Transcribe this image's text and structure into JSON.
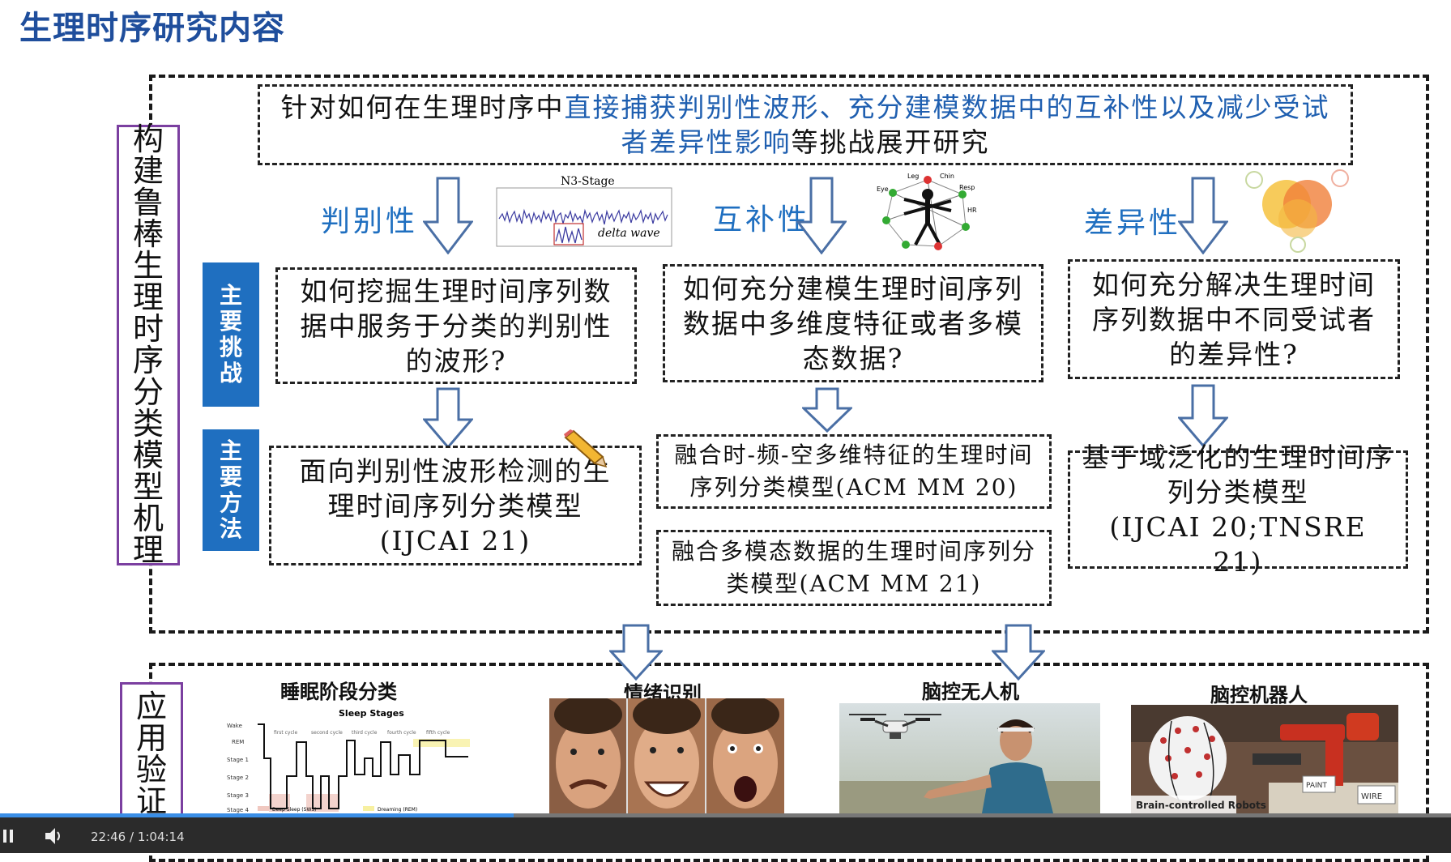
{
  "title": "生理时序研究内容",
  "left_labels": {
    "mechanism": "构建鲁棒生理时序分类模型机理",
    "application": "应用验证"
  },
  "intro": {
    "prefix": "针对如何在生理时序中",
    "highlight": "直接捕获判别性波形、充分建模数据中的互补性以及减少受试者差异性影响",
    "suffix": "等挑战展开研究"
  },
  "categories": [
    "判别性",
    "互补性",
    "差异性"
  ],
  "figures": {
    "n3_title": "N3-Stage",
    "n3_caption": "delta wave",
    "body_labels": [
      "Leg",
      "Chin",
      "Eye",
      "Resp",
      "HR"
    ]
  },
  "side_labels": {
    "challenges": "主要挑战",
    "methods": "主要方法"
  },
  "challenges": [
    "如何挖掘生理时间序列数据中服务于分类的判别性的波形?",
    "如何充分建模生理时间序列数据中多维度特征或者多模态数据?",
    "如何充分解决生理时间序列数据中不同受试者的差异性?"
  ],
  "methods": {
    "col1": [
      "面向判别性波形检测的生理时间序列分类模型",
      "(IJCAI 21)"
    ],
    "col2a": "融合时-频-空多维特征的生理时间序列分类模型(ACM MM 20)",
    "col2b": "融合多模态数据的生理时间序列分类模型(ACM MM 21)",
    "col3": [
      "基于域泛化的生理时间序列分类模型",
      "(IJCAI 20;TNSRE 21)"
    ]
  },
  "applications": [
    {
      "label": "睡眠阶段分类",
      "chart_title": "Sleep Stages",
      "y_levels": [
        "Wake",
        "REM",
        "Stage 1",
        "Stage 2",
        "Stage 3",
        "Stage 4"
      ],
      "cycles": [
        "first cycle",
        "second cycle",
        "third cycle",
        "fourth cycle",
        "fifth cycle"
      ],
      "legend": [
        "Deep Sleep (SWS)",
        "Dreaming (REM)"
      ]
    },
    {
      "label": "情绪识别"
    },
    {
      "label": "脑控无人机"
    },
    {
      "label": "脑控机器人",
      "caption": "Brain-controlled Robots",
      "sign1": "PAINT",
      "sign2": "WIRE"
    }
  ],
  "player": {
    "time": "22:46 / 1:04:14",
    "progress": 0.354
  },
  "colors": {
    "title_blue": "#1f4e9c",
    "accent_blue": "#1f6fc0",
    "purple": "#7b3fa0"
  }
}
